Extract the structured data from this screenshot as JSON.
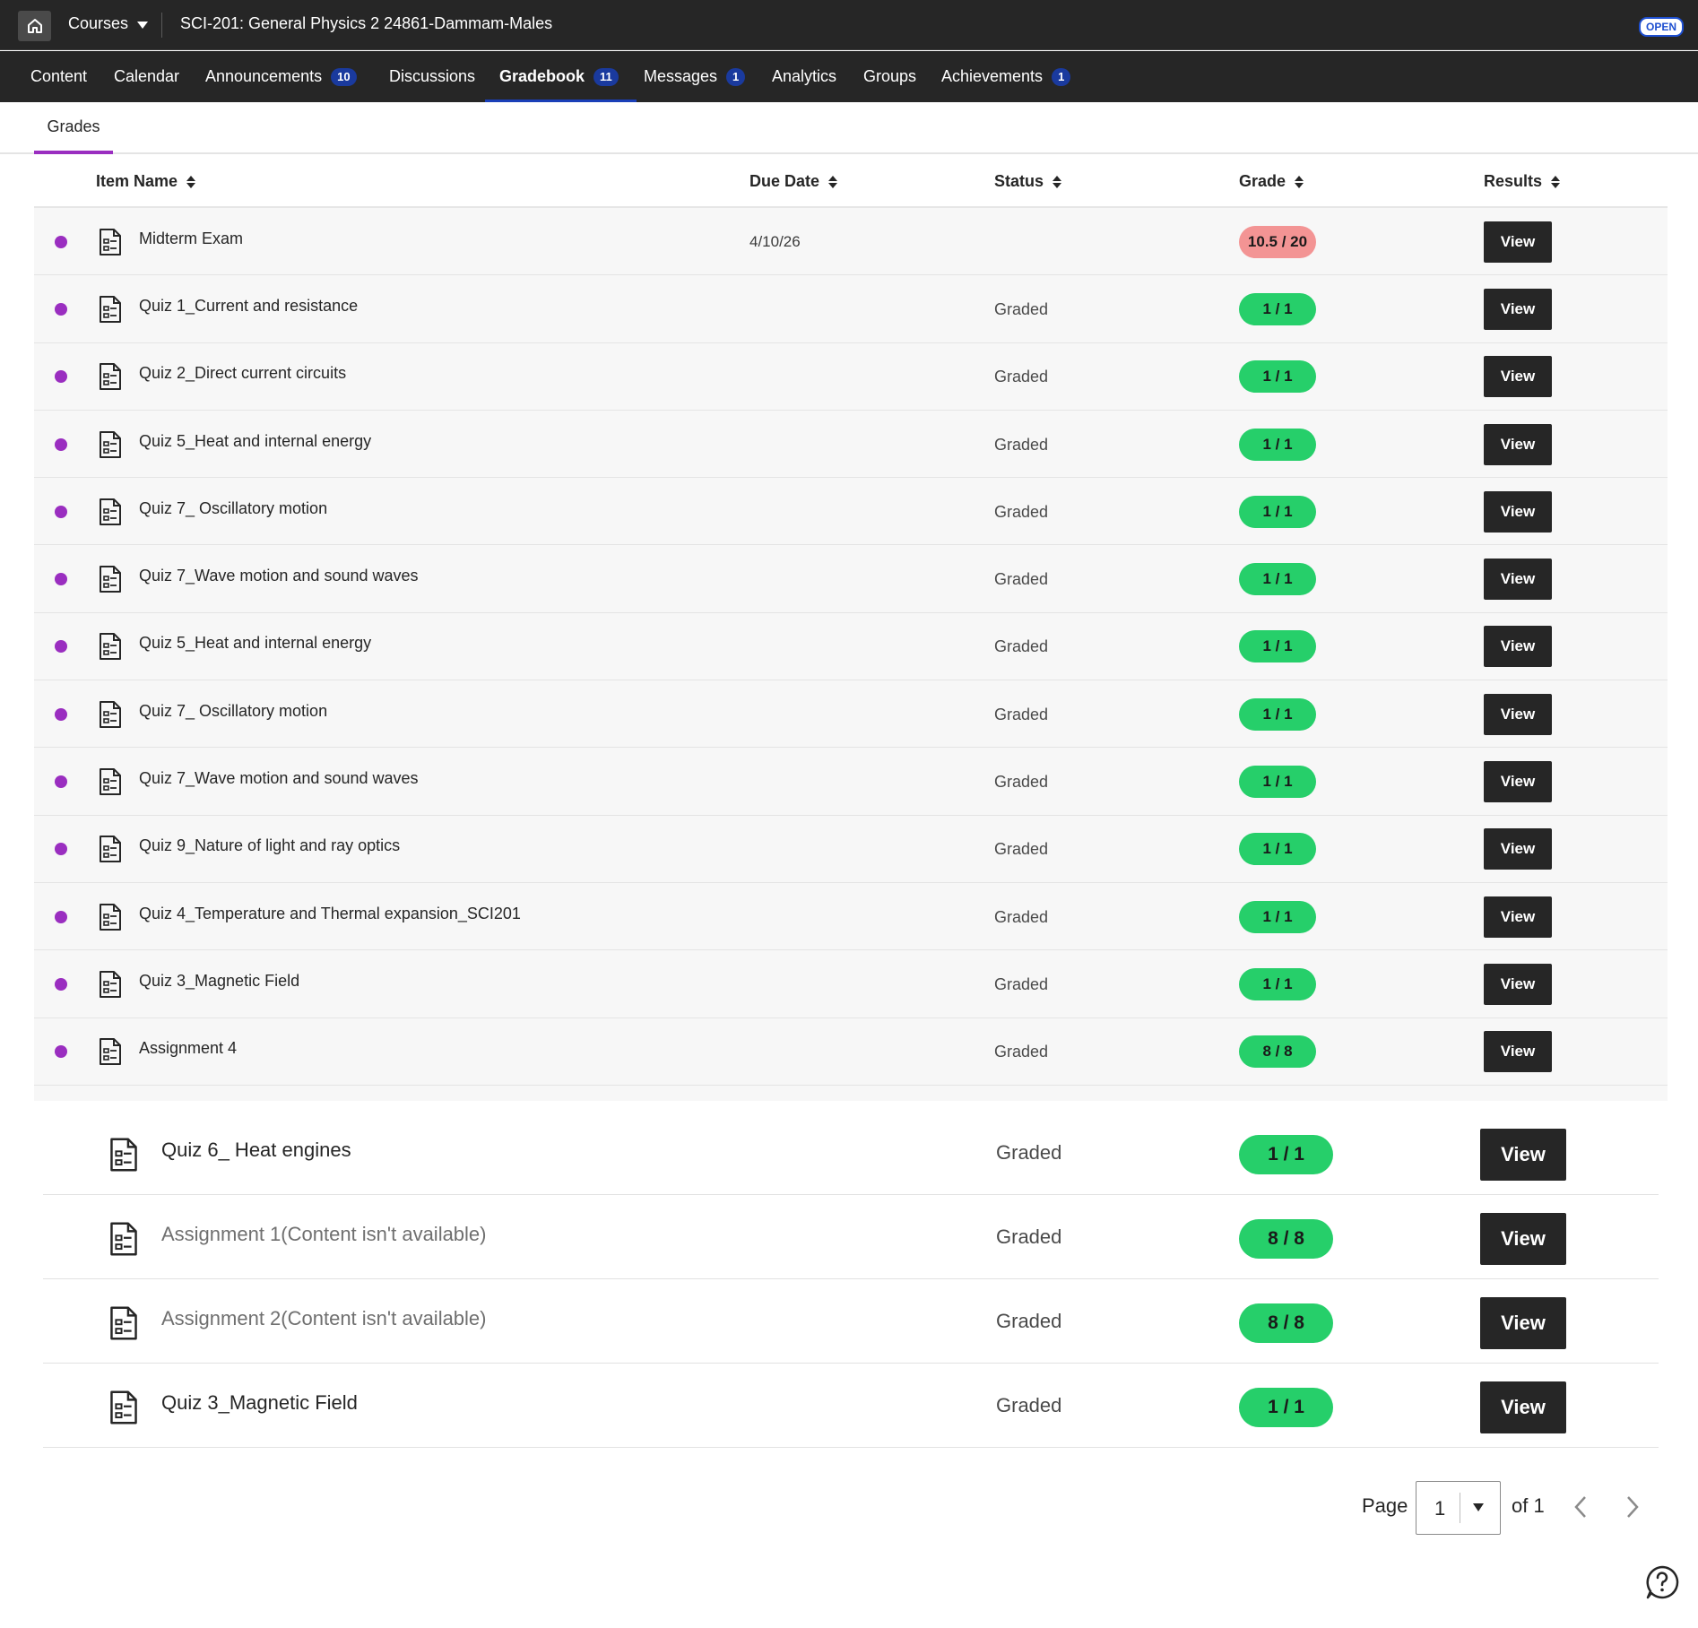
{
  "topbar": {
    "home_icon": "home-icon",
    "courses_label": "Courses",
    "course_title": "SCI-201: General Physics 2 24861-Dammam-Males",
    "open_badge": "OPEN"
  },
  "nav": {
    "items": [
      {
        "label": "Content",
        "count": ""
      },
      {
        "label": "Calendar",
        "count": ""
      },
      {
        "label": "Announcements",
        "count": "10"
      },
      {
        "label": "Discussions",
        "count": ""
      },
      {
        "label": "Gradebook",
        "count": "11",
        "active": true
      },
      {
        "label": "Messages",
        "count": "1"
      },
      {
        "label": "Analytics",
        "count": ""
      },
      {
        "label": "Groups",
        "count": ""
      },
      {
        "label": "Achievements",
        "count": "1"
      }
    ]
  },
  "tabs": {
    "grades": "Grades"
  },
  "table": {
    "columns": {
      "item_name": "Item Name",
      "due_date": "Due Date",
      "status": "Status",
      "grade": "Grade",
      "results": "Results"
    },
    "rows": [
      {
        "name": "Midterm Exam",
        "due": "4/10/26",
        "status": "",
        "grade": "10.5 / 20",
        "grade_state": "bad",
        "view": "View"
      },
      {
        "name": "Quiz 1_Current and resistance",
        "due": "",
        "status": "Graded",
        "grade": "1 / 1",
        "grade_state": "good",
        "view": "View"
      },
      {
        "name": "Quiz 2_Direct current circuits",
        "due": "",
        "status": "Graded",
        "grade": "1 / 1",
        "grade_state": "good",
        "view": "View"
      },
      {
        "name": "Quiz 5_Heat and internal energy",
        "due": "",
        "status": "Graded",
        "grade": "1 / 1",
        "grade_state": "good",
        "view": "View"
      },
      {
        "name": "Quiz 7_ Oscillatory motion",
        "due": "",
        "status": "Graded",
        "grade": "1 / 1",
        "grade_state": "good",
        "view": "View"
      },
      {
        "name": "Quiz 7_Wave motion and sound waves",
        "due": "",
        "status": "Graded",
        "grade": "1 / 1",
        "grade_state": "good",
        "view": "View"
      },
      {
        "name": "Quiz 5_Heat and internal energy",
        "due": "",
        "status": "Graded",
        "grade": "1 / 1",
        "grade_state": "good",
        "view": "View"
      },
      {
        "name": "Quiz 7_ Oscillatory motion",
        "due": "",
        "status": "Graded",
        "grade": "1 / 1",
        "grade_state": "good",
        "view": "View"
      },
      {
        "name": "Quiz 7_Wave motion and sound waves",
        "due": "",
        "status": "Graded",
        "grade": "1 / 1",
        "grade_state": "good",
        "view": "View"
      },
      {
        "name": "Quiz 9_Nature of light and ray optics",
        "due": "",
        "status": "Graded",
        "grade": "1 / 1",
        "grade_state": "good",
        "view": "View"
      },
      {
        "name": "Quiz 4_Temperature and Thermal expansion_SCI201",
        "due": "",
        "status": "Graded",
        "grade": "1 / 1",
        "grade_state": "good",
        "view": "View"
      },
      {
        "name": "Quiz 3_Magnetic Field",
        "due": "",
        "status": "Graded",
        "grade": "1 / 1",
        "grade_state": "good",
        "view": "View"
      },
      {
        "name": "Assignment 4",
        "due": "",
        "status": "Graded",
        "grade": "8 / 8",
        "grade_state": "good",
        "view": "View"
      }
    ],
    "zoomed_rows": [
      {
        "name": "Quiz 6_ Heat engines",
        "available": true,
        "status": "Graded",
        "grade": "1 / 1",
        "view": "View"
      },
      {
        "name": "Assignment 1(Content isn't available)",
        "available": false,
        "status": "Graded",
        "grade": "8 / 8",
        "view": "View"
      },
      {
        "name": "Assignment 2(Content isn't available)",
        "available": false,
        "status": "Graded",
        "grade": "8 / 8",
        "view": "View"
      },
      {
        "name": "Quiz 3_Magnetic Field",
        "available": true,
        "status": "Graded",
        "grade": "1 / 1",
        "view": "View"
      }
    ]
  },
  "pagination": {
    "page_label": "Page",
    "current": "1",
    "of_label": "of 1"
  },
  "colors": {
    "topbar_bg": "#262626",
    "accent_purple": "#9a2ec0",
    "badge_blue": "#1a3a9e",
    "grade_good": "#26cf6a",
    "grade_bad": "#f39494"
  }
}
